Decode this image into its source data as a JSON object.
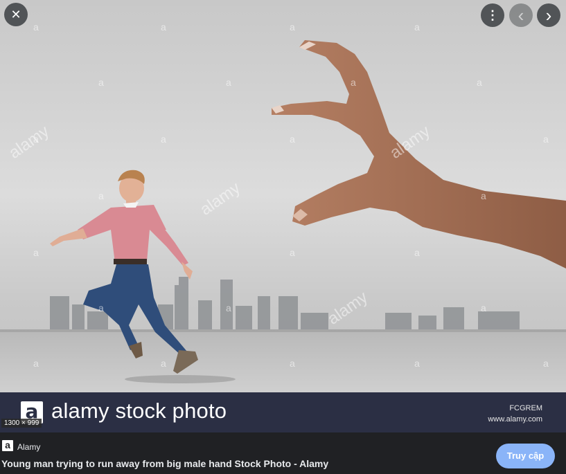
{
  "toolbar": {
    "close_glyph": "✕",
    "more_glyph": "⋮",
    "prev_glyph": "‹",
    "next_glyph": "›"
  },
  "image": {
    "watermark": {
      "logo_letter": "a",
      "brand": "alamy stock photo",
      "image_id": "FCGREM",
      "url": "www.alamy.com",
      "tile_text": "alamy",
      "tile_letter": "a"
    },
    "dimensions": "1300 × 999"
  },
  "result": {
    "site_icon_letter": "a",
    "site_name": "Alamy",
    "title": "Young man trying to run away from big male hand Stock Photo - Alamy",
    "visit_label": "Truy cập"
  },
  "colors": {
    "watermark_bar": "#2b2f44",
    "visit_button": "#8ab4f8",
    "panel_bg": "#202124"
  },
  "icons": [
    "close-icon",
    "more-vert-icon",
    "chevron-left-icon",
    "chevron-right-icon"
  ]
}
